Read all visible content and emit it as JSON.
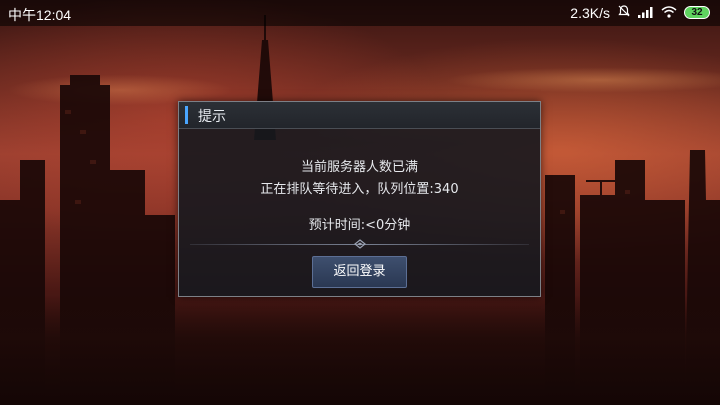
{
  "status_bar": {
    "time": "中午12:04",
    "net_speed": "2.3K/s",
    "battery": "32",
    "icons": [
      "bell-off-icon",
      "signal-icon",
      "wifi-icon",
      "battery-icon"
    ]
  },
  "dialog": {
    "title": "提示",
    "line1": "当前服务器人数已满",
    "line2": "正在排队等待进入，队列位置:340",
    "line3": "预计时间:<0分钟",
    "back_button": "返回登录"
  },
  "colors": {
    "accent": "#4aa6ff",
    "button_bg": "#34466a",
    "battery_fill": "#5fd35f"
  }
}
